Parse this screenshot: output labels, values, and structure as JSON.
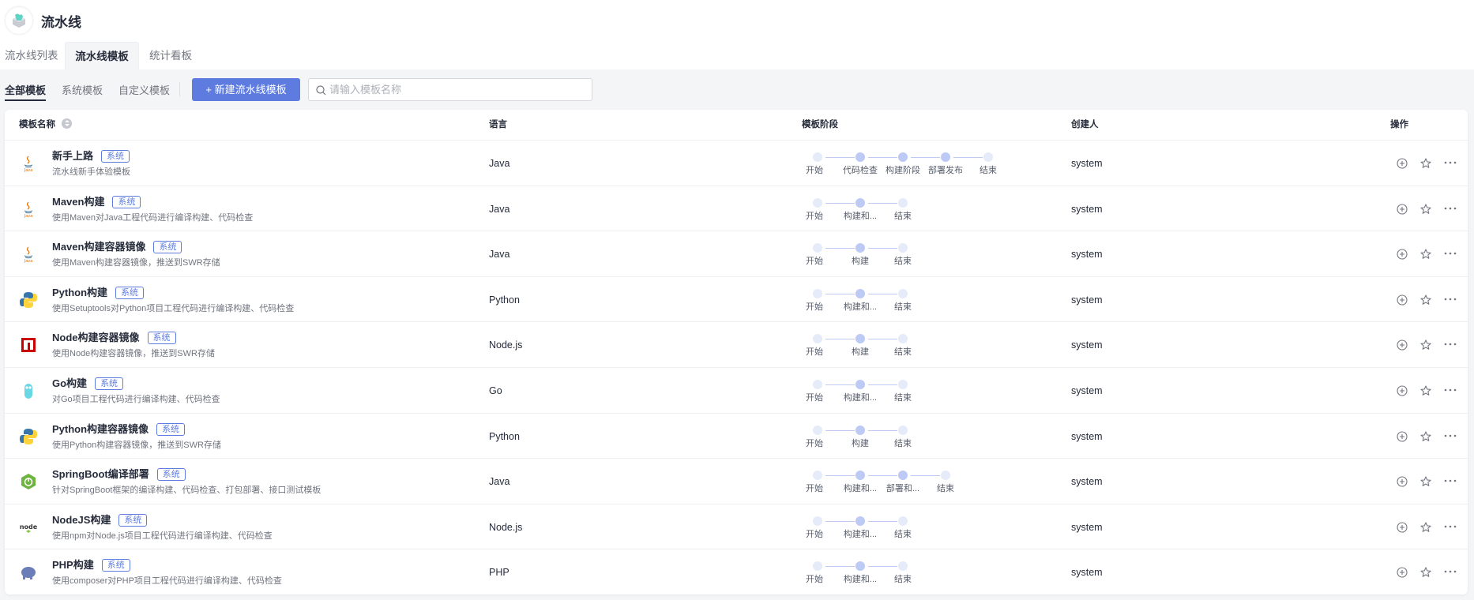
{
  "header": {
    "title": "流水线"
  },
  "tabs": [
    {
      "label": "流水线列表"
    },
    {
      "label": "流水线模板"
    },
    {
      "label": "统计看板"
    }
  ],
  "subtabs": [
    {
      "label": "全部模板"
    },
    {
      "label": "系统模板"
    },
    {
      "label": "自定义模板"
    }
  ],
  "new_button": "+ 新建流水线模板",
  "search": {
    "placeholder": "请输入模板名称",
    "value": ""
  },
  "columns": {
    "name": "模板名称",
    "language": "语言",
    "stages": "模板阶段",
    "creator": "创建人",
    "actions": "操作"
  },
  "rows": [
    {
      "icon": "java-icon",
      "name": "新手上路",
      "badge": "系统",
      "desc": "流水线新手体验模板",
      "lang": "Java",
      "stages": [
        "开始",
        "代码检查",
        "构建阶段",
        "部署发布",
        "结束"
      ],
      "creator": "system"
    },
    {
      "icon": "java-icon",
      "name": "Maven构建",
      "badge": "系统",
      "desc": "使用Maven对Java工程代码进行编译构建、代码检查",
      "lang": "Java",
      "stages": [
        "开始",
        "构建和...",
        "结束"
      ],
      "creator": "system"
    },
    {
      "icon": "java-icon",
      "name": "Maven构建容器镜像",
      "badge": "系统",
      "desc": "使用Maven构建容器镜像，推送到SWR存储",
      "lang": "Java",
      "stages": [
        "开始",
        "构建",
        "结束"
      ],
      "creator": "system"
    },
    {
      "icon": "python-icon",
      "name": "Python构建",
      "badge": "系统",
      "desc": "使用Setuptools对Python项目工程代码进行编译构建、代码检查",
      "lang": "Python",
      "stages": [
        "开始",
        "构建和...",
        "结束"
      ],
      "creator": "system"
    },
    {
      "icon": "npm-icon",
      "name": "Node构建容器镜像",
      "badge": "系统",
      "desc": "使用Node构建容器镜像，推送到SWR存储",
      "lang": "Node.js",
      "stages": [
        "开始",
        "构建",
        "结束"
      ],
      "creator": "system"
    },
    {
      "icon": "go-gopher-icon",
      "name": "Go构建",
      "badge": "系统",
      "desc": "对Go项目工程代码进行编译构建、代码检查",
      "lang": "Go",
      "stages": [
        "开始",
        "构建和...",
        "结束"
      ],
      "creator": "system"
    },
    {
      "icon": "python-icon",
      "name": "Python构建容器镜像",
      "badge": "系统",
      "desc": "使用Python构建容器镜像，推送到SWR存储",
      "lang": "Python",
      "stages": [
        "开始",
        "构建",
        "结束"
      ],
      "creator": "system"
    },
    {
      "icon": "spring-icon",
      "name": "SpringBoot编译部署",
      "badge": "系统",
      "desc": "针对SpringBoot框架的编译构建、代码检查、打包部署、接口测试模板",
      "lang": "Java",
      "stages": [
        "开始",
        "构建和...",
        "部署和...",
        "结束"
      ],
      "creator": "system"
    },
    {
      "icon": "nodejs-icon",
      "name": "NodeJS构建",
      "badge": "系统",
      "desc": "使用npm对Node.js项目工程代码进行编译构建、代码检查",
      "lang": "Node.js",
      "stages": [
        "开始",
        "构建和...",
        "结束"
      ],
      "creator": "system"
    },
    {
      "icon": "php-elephant-icon",
      "name": "PHP构建",
      "badge": "系统",
      "desc": "使用composer对PHP项目工程代码进行编译构建、代码检查",
      "lang": "PHP",
      "stages": [
        "开始",
        "构建和...",
        "结束"
      ],
      "creator": "system"
    }
  ],
  "colors": {
    "accent": "#5e7ce0",
    "stage_active": "#bccaf5",
    "stage_end": "#e6ebf9"
  }
}
